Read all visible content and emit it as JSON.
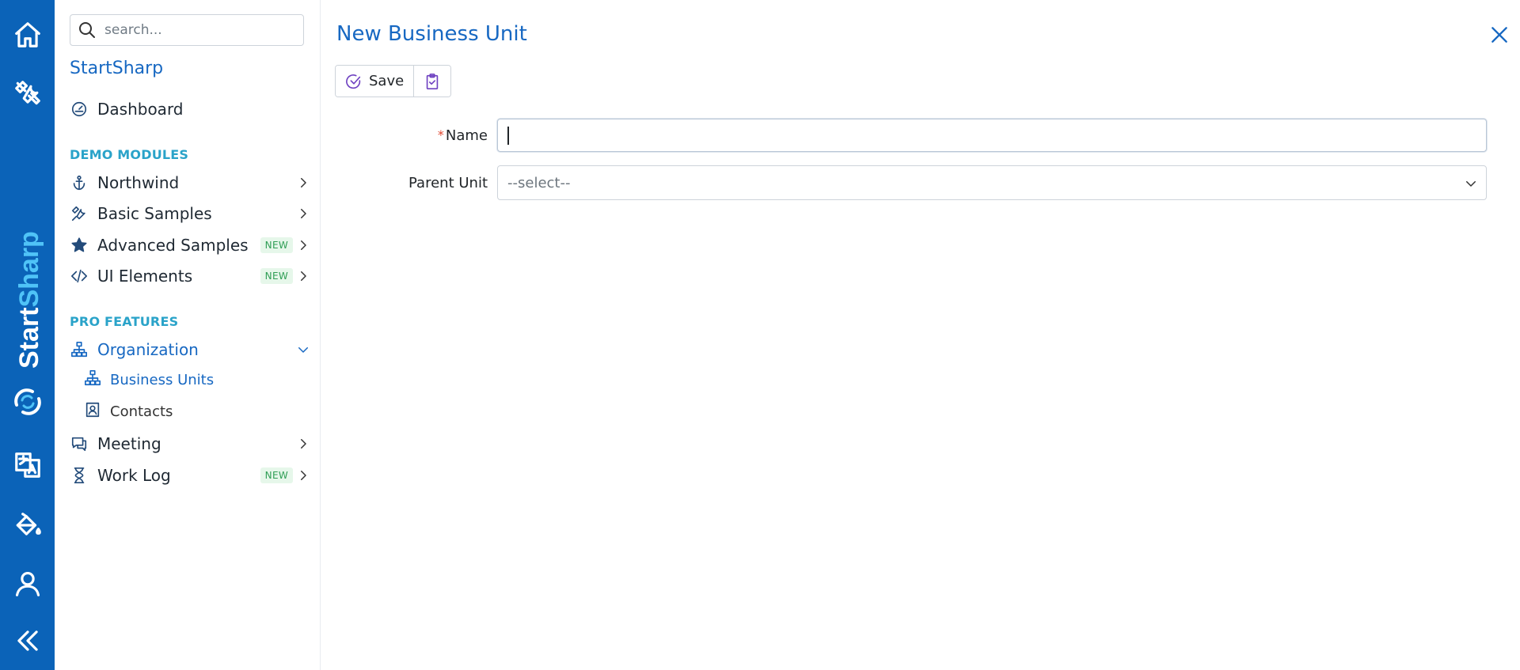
{
  "rail": {
    "brand_text_start": "Start",
    "brand_text_sharp": "Sharp",
    "icons": [
      "home-icon",
      "tools-icon",
      "translate-icon",
      "paint-bucket-icon",
      "user-icon",
      "collapse-icon"
    ]
  },
  "sidebar": {
    "search_placeholder": "search...",
    "app_name": "StartSharp",
    "dashboard": "Dashboard",
    "demo_modules_title": "DEMO MODULES",
    "demo_items": [
      {
        "label": "Northwind",
        "icon": "anchor-icon",
        "badge": ""
      },
      {
        "label": "Basic Samples",
        "icon": "tools-icon",
        "badge": ""
      },
      {
        "label": "Advanced Samples",
        "icon": "star-icon",
        "badge": "NEW"
      },
      {
        "label": "UI Elements",
        "icon": "code-icon",
        "badge": "NEW"
      }
    ],
    "pro_features_title": "PRO FEATURES",
    "organization": "Organization",
    "org_children": [
      {
        "label": "Business Units",
        "icon": "org-chart-icon"
      },
      {
        "label": "Contacts",
        "icon": "contact-card-icon"
      }
    ],
    "meeting": "Meeting",
    "work_log": "Work Log",
    "work_log_badge": "NEW"
  },
  "main": {
    "title": "New Business Unit",
    "toolbar": {
      "save_label": "Save"
    },
    "form": {
      "name_label": "Name",
      "name_required": "*",
      "name_value": "",
      "parent_label": "Parent Unit",
      "parent_value": "--select--"
    }
  },
  "colors": {
    "rail": "#0b63b8",
    "accent": "#1768c2",
    "section": "#2aa3c9",
    "badge_bg": "#e6f7ea",
    "badge_text": "#2f9e55",
    "toolbar_icon": "#6f42c1"
  }
}
